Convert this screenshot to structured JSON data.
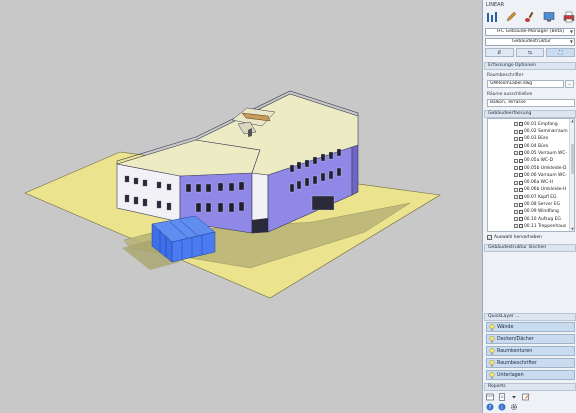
{
  "app": {
    "title": "LINEAR"
  },
  "toolbar": {
    "icons": [
      "column-chart-icon",
      "pen-icon",
      "brush-icon",
      "monitor-icon",
      "printer-icon"
    ]
  },
  "manager_select": {
    "value": "IFC Gebäude-Manager [Beta]"
  },
  "structure_select": {
    "value": "Gebäudestruktur"
  },
  "tabs": [
    {
      "label": "⇵",
      "icon": "sort-icon"
    },
    {
      "label": "⇆",
      "icon": "swap-icon"
    },
    {
      "label": "⛶",
      "icon": "fit-view-icon"
    }
  ],
  "acquisition": {
    "header": "Erfassungs-Optionen",
    "room_label_title": "Raumbeschrifter",
    "room_label_value": "GMRoomLabel.dwg",
    "browse": "...",
    "exclude_title": "Räume ausschließen",
    "exclude_value": "Balkon, Terrasse"
  },
  "building": {
    "header": "Gebäudeerfassung",
    "rooms": [
      "00.01 Empfang",
      "00.02 Seminarraum",
      "00.03 Büro",
      "00.04 Büro",
      "00.05 Vorraum WC-",
      "00.05a WC-D",
      "00.05b Umkleide-D",
      "00.06 Vorraum WC-",
      "00.06a WC-H",
      "00.06b Umkleide-H",
      "00.07 Kopfl EG",
      "00.08 Server EG",
      "00.09 Windfang",
      "00.10 Aufzug EG",
      "00.11 Treppenhaus"
    ],
    "highlight_checkbox": "Auswahl hervorheben",
    "delete_button": "Gebäudestruktur löschen"
  },
  "quicklayer": {
    "header": "QuickLayer ...",
    "items": [
      "Wände",
      "Decken/Dächer",
      "Raumkonturen",
      "Raumbeschrifter",
      "Unterlagen"
    ]
  },
  "reports": {
    "header": "Reports"
  },
  "colors": {
    "facade": "#8f88e6",
    "roof": "#ecebc4",
    "ground": "#ece38f",
    "glass": "#3d6fe8",
    "panel_bg": "#eef2f7",
    "quicklayer_bg": "#c9dcef"
  }
}
